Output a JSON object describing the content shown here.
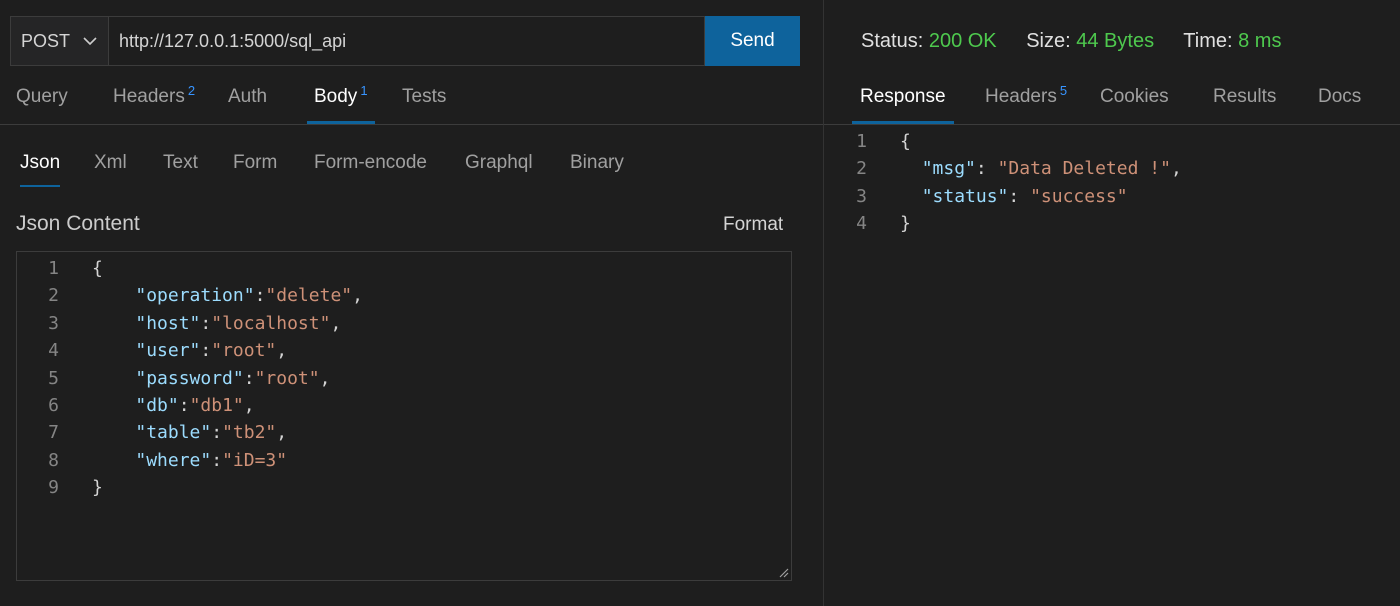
{
  "request": {
    "method": "POST",
    "url": "http://127.0.0.1:5000/sql_api",
    "send_label": "Send"
  },
  "request_tabs": [
    {
      "label": "Query",
      "badge": ""
    },
    {
      "label": "Headers",
      "badge": "2"
    },
    {
      "label": "Auth",
      "badge": ""
    },
    {
      "label": "Body",
      "badge": "1",
      "active": true
    },
    {
      "label": "Tests",
      "badge": ""
    }
  ],
  "body_tabs": [
    {
      "label": "Json",
      "active": true
    },
    {
      "label": "Xml"
    },
    {
      "label": "Text"
    },
    {
      "label": "Form"
    },
    {
      "label": "Form-encode"
    },
    {
      "label": "Graphql"
    },
    {
      "label": "Binary"
    }
  ],
  "editor": {
    "title": "Json Content",
    "format_label": "Format",
    "lines": [
      {
        "n": "1",
        "indent": "",
        "key": "",
        "value": "",
        "text": "{"
      },
      {
        "n": "2",
        "indent": "    ",
        "key": "\"operation\"",
        "value": "\"delete\"",
        "text": ","
      },
      {
        "n": "3",
        "indent": "    ",
        "key": "\"host\"",
        "value": "\"localhost\"",
        "text": ","
      },
      {
        "n": "4",
        "indent": "    ",
        "key": "\"user\"",
        "value": "\"root\"",
        "text": ","
      },
      {
        "n": "5",
        "indent": "    ",
        "key": "\"password\"",
        "value": "\"root\"",
        "text": ","
      },
      {
        "n": "6",
        "indent": "    ",
        "key": "\"db\"",
        "value": "\"db1\"",
        "text": ","
      },
      {
        "n": "7",
        "indent": "    ",
        "key": "\"table\"",
        "value": "\"tb2\"",
        "text": ","
      },
      {
        "n": "8",
        "indent": "    ",
        "key": "\"where\"",
        "value": "\"iD=3\"",
        "text": ""
      },
      {
        "n": "9",
        "indent": "",
        "key": "",
        "value": "",
        "text": "}"
      }
    ]
  },
  "response": {
    "status_label": "Status:",
    "status_value": "200 OK",
    "size_label": "Size:",
    "size_value": "44 Bytes",
    "time_label": "Time:",
    "time_value": "8 ms"
  },
  "response_tabs": [
    {
      "label": "Response",
      "badge": "",
      "active": true
    },
    {
      "label": "Headers",
      "badge": "5"
    },
    {
      "label": "Cookies",
      "badge": ""
    },
    {
      "label": "Results",
      "badge": ""
    },
    {
      "label": "Docs",
      "badge": ""
    }
  ],
  "response_body": [
    {
      "n": "1",
      "indent": "",
      "key": "",
      "value": "",
      "text": "{"
    },
    {
      "n": "2",
      "indent": "  ",
      "key": "\"msg\"",
      "value": "\"Data Deleted !\"",
      "text": ","
    },
    {
      "n": "3",
      "indent": "  ",
      "key": "\"status\"",
      "value": "\"success\"",
      "text": ""
    },
    {
      "n": "4",
      "indent": "",
      "key": "",
      "value": "",
      "text": "}"
    }
  ],
  "colors": {
    "accent": "#0e639c",
    "status_green": "#4ec94e",
    "json_key": "#9cdcfe",
    "json_string": "#ce9178"
  },
  "icons": {
    "method_dropdown": "chevron-down-icon",
    "editor_resize": "resize-handle-icon"
  }
}
